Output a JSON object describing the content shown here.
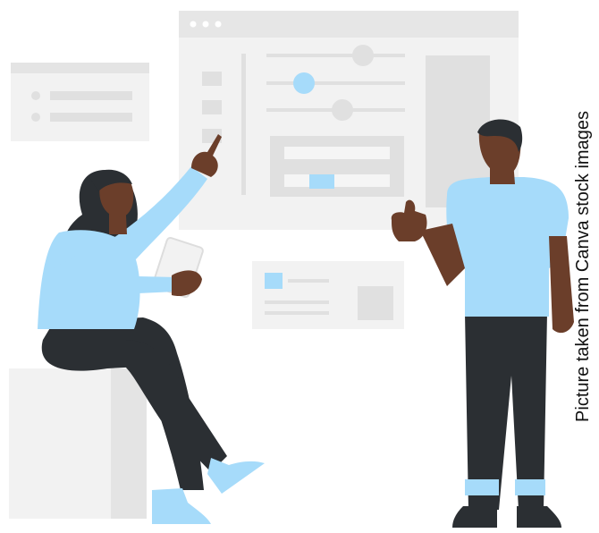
{
  "caption": "Picture taken from Canva stock images",
  "colors": {
    "panel": "#f2f2f2",
    "panel_bar": "#e4e4e4",
    "block": "#dedede",
    "accent": "#a6dbfa",
    "skin": "#6b3e2a",
    "hair": "#2b2f33",
    "pants": "#2b2f33",
    "shirt": "#a6dbfa"
  },
  "icons": [
    "window-dots-icon",
    "slider-knob-icon",
    "tablet-icon",
    "thumbs-up-icon",
    "pointing-hand-icon"
  ]
}
